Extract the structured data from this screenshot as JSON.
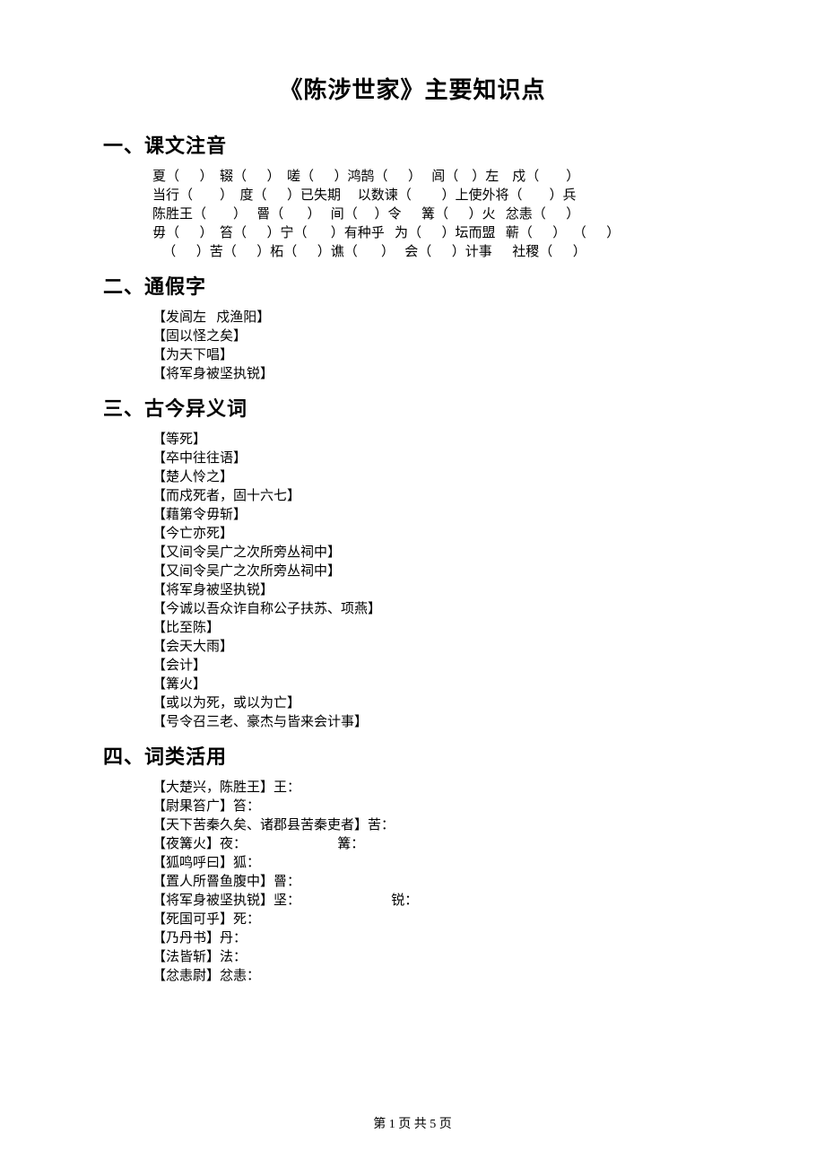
{
  "title": "《陈涉世家》主要知识点",
  "sections": {
    "s1": {
      "head": "一、课文注音",
      "lines": [
        "夏（      ）  辍（      ）  嗟（      ）鸿鹄（      ）   闾（    ）左    戍（        ）",
        "当行（        ）  度（      ）已失期     以数谏（         ）上使外将（        ）兵",
        "陈胜王（        ）   罾（       ）   间（     ）令      篝（      ）火   忿恚（      ）",
        "毋（      ）  笞（      ）宁（       ）有种乎   为（      ）坛而盟   蕲（      ）  （      ）",
        "   （      ）苦（      ）柘（      ）谯（       ）   会（      ）计事      社稷（      ）"
      ]
    },
    "s2": {
      "head": "二、通假字",
      "lines": [
        "【发闾左   戍渔阳】",
        "【固以怪之矣】",
        "【为天下唱】",
        "【将军身被坚执锐】"
      ]
    },
    "s3": {
      "head": "三、古今异义词",
      "lines": [
        "【等死】",
        "【卒中往往语】",
        "【楚人怜之】",
        "【而戍死者，固十六七】",
        "【藉第令毋斩】",
        "【今亡亦死】",
        "【又间令吴广之次所旁丛祠中】",
        "【又间令吴广之次所旁丛祠中】",
        "【将军身被坚执锐】",
        "【今诚以吾众诈自称公子扶苏、项燕】",
        "【比至陈】",
        "【会天大雨】",
        "【会计】",
        "【篝火】",
        "【或以为死，或以为亡】",
        "【号令召三老、豪杰与皆来会计事】"
      ]
    },
    "s4": {
      "head": "四、词类活用",
      "lines": [
        "【大楚兴，陈胜王】王：",
        "【尉果笞广】笞：",
        "【天下苦秦久矣、诸郡县苦秦吏者】苦：",
        "【夜篝火】夜：                           篝：",
        "【狐鸣呼曰】狐：",
        "【置人所罾鱼腹中】罾：",
        "【将军身被坚执锐】坚：                           锐：",
        "【死国可乎】死：",
        "【乃丹书】丹：",
        "【法皆斩】法：",
        "【忿恚尉】忿恚："
      ]
    }
  },
  "footer": "第 1 页 共 5 页"
}
